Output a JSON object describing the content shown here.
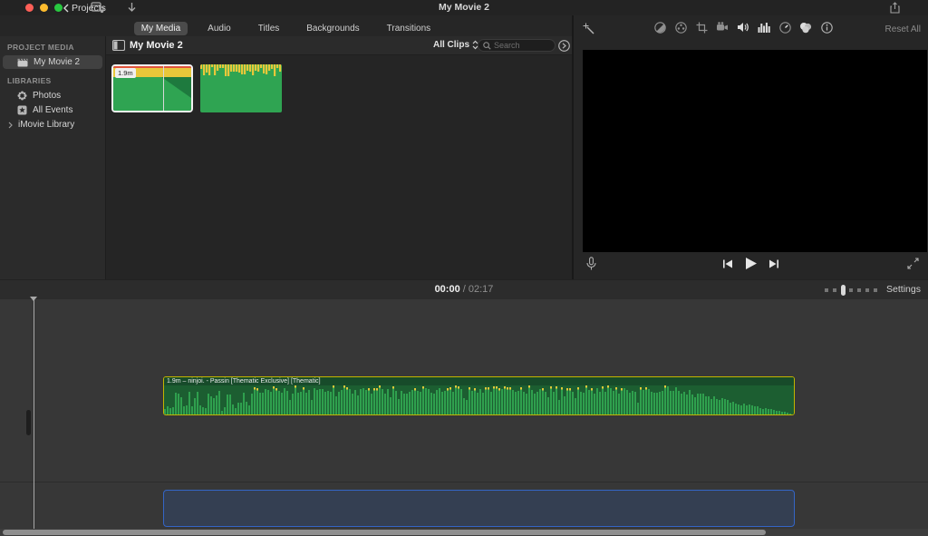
{
  "titlebar": {
    "back_label": "Projects",
    "title": "My Movie 2"
  },
  "tabs": {
    "selected": "My Media",
    "items": [
      {
        "label": "My Media"
      },
      {
        "label": "Audio"
      },
      {
        "label": "Titles"
      },
      {
        "label": "Backgrounds"
      },
      {
        "label": "Transitions"
      }
    ]
  },
  "sidebar": {
    "project_media_header": "PROJECT MEDIA",
    "libraries_header": "LIBRARIES",
    "project_items": [
      {
        "label": "My Movie 2",
        "icon": "clapperboard-icon",
        "selected": true
      }
    ],
    "library_items": [
      {
        "label": "Photos",
        "icon": "photos-pinwheel-icon"
      },
      {
        "label": "All Events",
        "icon": "star-icon"
      },
      {
        "label": "iMovie Library",
        "icon": "chevron-right-icon"
      }
    ]
  },
  "browser": {
    "title": "My Movie 2",
    "filter_label": "All Clips",
    "search_placeholder": "Search",
    "clips": [
      {
        "badge": "1.9m",
        "selected": true
      },
      {
        "selected": false
      }
    ],
    "clip_colors": {
      "green": "#2fa452",
      "yellow": "#e8c73a",
      "red": "#e2543c",
      "dark_wedge": "#1e7a3e"
    }
  },
  "viewer": {
    "reset_label": "Reset All",
    "icons": [
      "enhance-wand",
      "color-balance",
      "color-correction",
      "crop",
      "stabilization",
      "volume",
      "noise-reduction",
      "speed",
      "clip-filter",
      "clip-info"
    ]
  },
  "timeline": {
    "current_time": "00:00",
    "duration": "02:17",
    "settings_label": "Settings",
    "clip": {
      "label": "1.9m – ninjoi. - Passin [Thematic Exclusive] [Thematic]"
    },
    "waveform": {
      "bars": 231,
      "quiet_end": 0.135,
      "fade_start": 0.8,
      "peak_threshold": 0.9,
      "colors": {
        "background": "#1c5e31",
        "bar": "#2fa04e",
        "peak": "#e2c83a",
        "label_bg": "#174b2a",
        "border": "#c3b400"
      }
    },
    "music_well": {
      "fill": "#343f52",
      "border": "#3465c6"
    }
  }
}
